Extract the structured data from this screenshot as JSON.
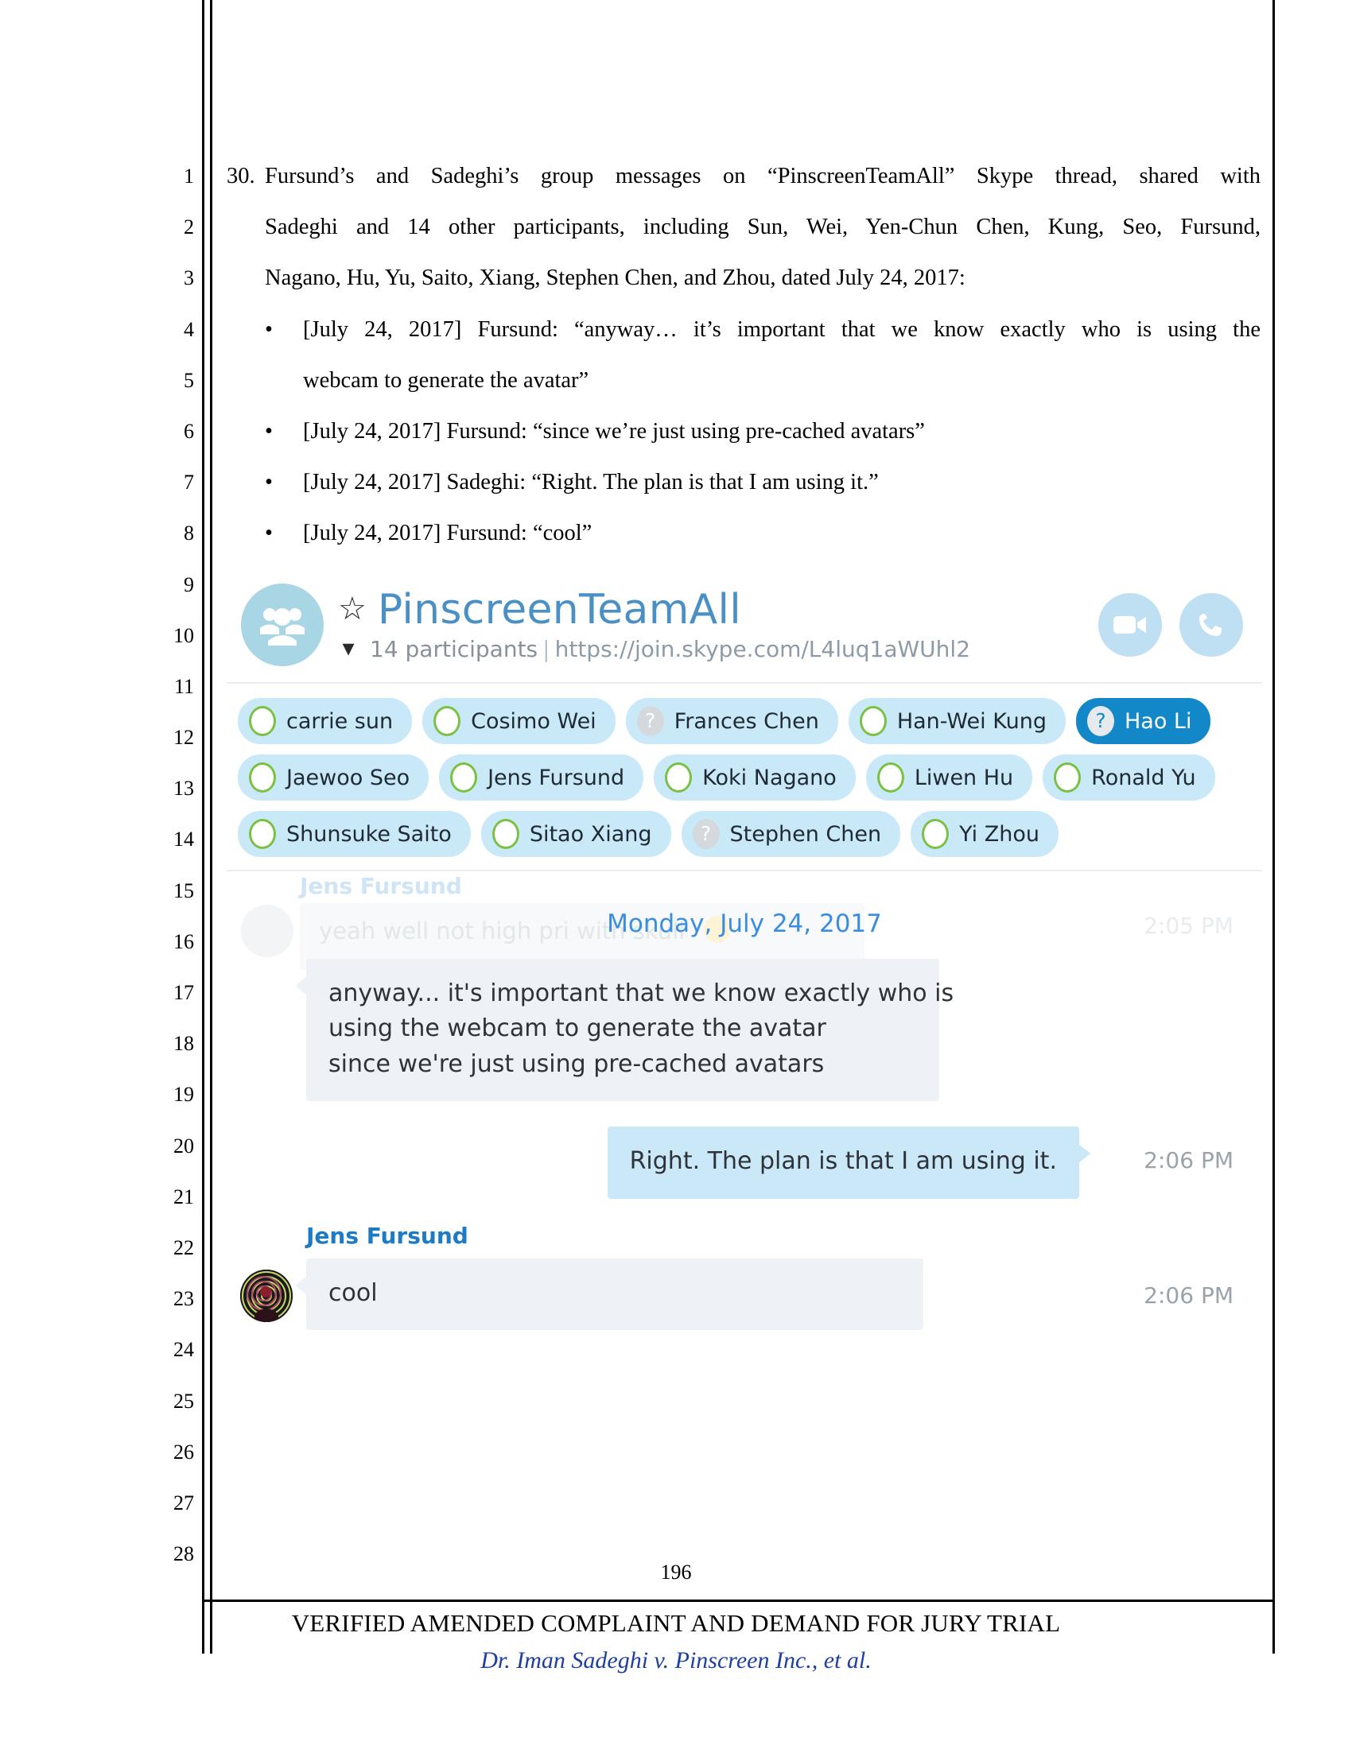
{
  "document": {
    "paragraph_number": "30.",
    "paragraph_text_line1": "Fursund’s and Sadeghi’s group messages on “PinscreenTeamAll” Skype thread, shared with",
    "paragraph_text_line2": "Sadeghi and 14 other participants, including Sun, Wei, Yen-Chun Chen, Kung, Seo, Fursund,",
    "paragraph_text_line3": "Nagano, Hu, Yu, Saito, Xiang, Stephen Chen, and Zhou, dated July 24, 2017:",
    "bullets": [
      {
        "line1": "[July 24, 2017] Fursund: “anyway… it’s important that we know exactly who is using the",
        "line2": "webcam to generate the avatar”"
      },
      {
        "line1": "[July 24, 2017] Fursund: “since we’re just using pre-cached avatars”",
        "line2": ""
      },
      {
        "line1": "[July 24, 2017] Sadeghi: “Right. The plan is that I am using it.”",
        "line2": ""
      },
      {
        "line1": "[July 24, 2017] Fursund: “cool”",
        "line2": ""
      }
    ],
    "line_numbers": [
      "1",
      "2",
      "3",
      "4",
      "5",
      "6",
      "7",
      "8",
      "9",
      "10",
      "11",
      "12",
      "13",
      "14",
      "15",
      "16",
      "17",
      "18",
      "19",
      "20",
      "21",
      "22",
      "23",
      "24",
      "25",
      "26",
      "27",
      "28"
    ],
    "page_number": "196",
    "footer_title": "VERIFIED AMENDED COMPLAINT AND DEMAND FOR JURY TRIAL",
    "footer_subtitle": "Dr. Iman Sadeghi v. Pinscreen Inc., et al."
  },
  "skype": {
    "header": {
      "group_avatar_icon": "people-group-icon",
      "favorite_icon": "star-icon",
      "title": "PinscreenTeamAll",
      "expand_icon": "chevron-down-icon",
      "participant_count_label": "14 participants",
      "separator": "|",
      "join_url": "https://join.skype.com/L4luq1aWUhl2",
      "video_call_icon": "video-camera-icon",
      "audio_call_icon": "phone-icon"
    },
    "participants": [
      [
        {
          "name": "carrie sun",
          "presence": "online",
          "active": false
        },
        {
          "name": "Cosimo Wei",
          "presence": "online",
          "active": false
        },
        {
          "name": "Frances Chen",
          "presence": "unknown",
          "active": false
        },
        {
          "name": "Han-Wei Kung",
          "presence": "online",
          "active": false
        },
        {
          "name": "Hao Li",
          "presence": "unknown",
          "active": true
        }
      ],
      [
        {
          "name": "Jaewoo Seo",
          "presence": "online",
          "active": false
        },
        {
          "name": "Jens Fursund",
          "presence": "online",
          "active": false
        },
        {
          "name": "Koki Nagano",
          "presence": "online",
          "active": false
        },
        {
          "name": "Liwen Hu",
          "presence": "online",
          "active": false
        },
        {
          "name": "Ronald Yu",
          "presence": "online",
          "active": false
        }
      ],
      [
        {
          "name": "Shunsuke Saito",
          "presence": "online",
          "active": false
        },
        {
          "name": "Sitao Xiang",
          "presence": "online",
          "active": false
        },
        {
          "name": "Stephen Chen",
          "presence": "unknown",
          "active": false
        },
        {
          "name": "Yi Zhou",
          "presence": "online",
          "active": false
        }
      ]
    ],
    "unknown_presence_glyph": "?",
    "conversation": {
      "faded_sender": "Jens Fursund",
      "faded_message": "yeah well not high pri with skull",
      "faded_time": "2:05 PM",
      "date_divider": "Monday, July 24, 2017",
      "messages": [
        {
          "kind": "incoming",
          "sender": "",
          "lines": [
            "anyway... it's important that we know exactly who is",
            "using the webcam to generate the avatar",
            "since we're just using pre-cached avatars"
          ],
          "time": ""
        },
        {
          "kind": "outgoing",
          "sender": "",
          "lines": [
            "Right. The plan is that I am using it."
          ],
          "time": "2:06 PM"
        },
        {
          "kind": "incoming",
          "sender": "Jens Fursund",
          "lines": [
            "cool"
          ],
          "time": "2:06 PM"
        }
      ]
    }
  }
}
